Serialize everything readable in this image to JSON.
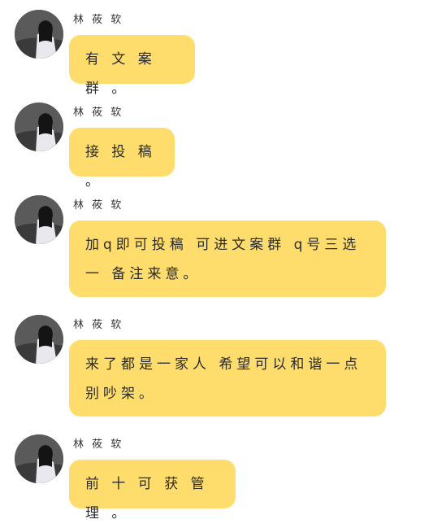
{
  "chat": {
    "messages": [
      {
        "sender": "林 莜 软",
        "text": "有 文 案 群 。"
      },
      {
        "sender": "林 莜 软",
        "text": "接 投 稿 。"
      },
      {
        "sender": "林 莜 软",
        "text": "加q即可投稿 可进文案群 q号三选一 备注来意。"
      },
      {
        "sender": "林 莜 软",
        "text": "来了都是一家人 希望可以和谐一点 别吵架。"
      },
      {
        "sender": "林 莜 软",
        "text": "前 十 可 获 管 理 。"
      }
    ]
  },
  "colors": {
    "bubble": "#fedd6c",
    "background": "#ffffff"
  },
  "icons": {
    "avatar": "avatar-photo"
  }
}
